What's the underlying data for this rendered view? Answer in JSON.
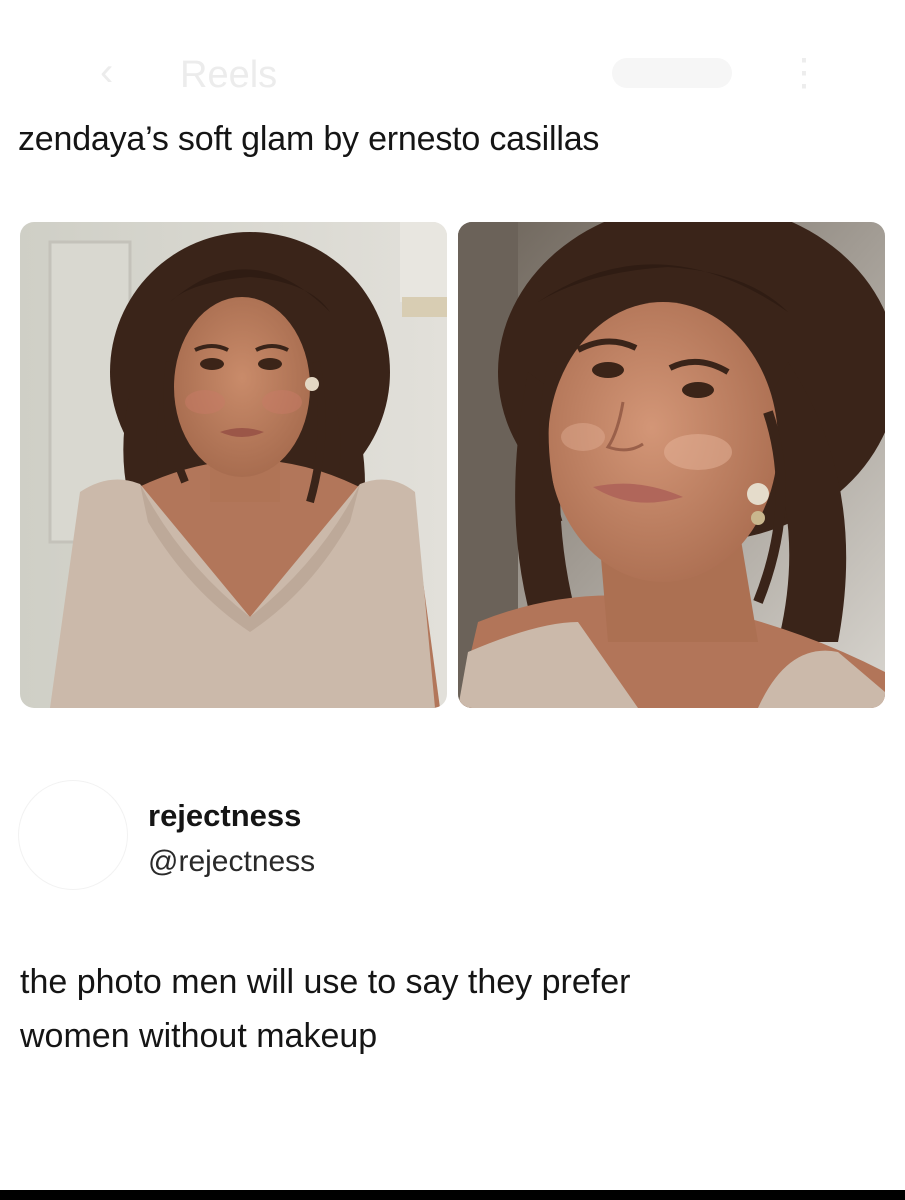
{
  "background_header": {
    "title": "Reels"
  },
  "post": {
    "caption": "zendaya’s soft glam by ernesto casillas",
    "photos": [
      "photo-left",
      "photo-right"
    ]
  },
  "tweet": {
    "display_name": "rejectness",
    "handle": "@rejectness",
    "text_line_1": "the photo men will use to say they prefer",
    "text_line_2": "women without makeup"
  },
  "colors": {
    "text": "#151515",
    "dress": "#cbb9aa",
    "hair": "#3a2419",
    "skin": "#b57a5c"
  }
}
